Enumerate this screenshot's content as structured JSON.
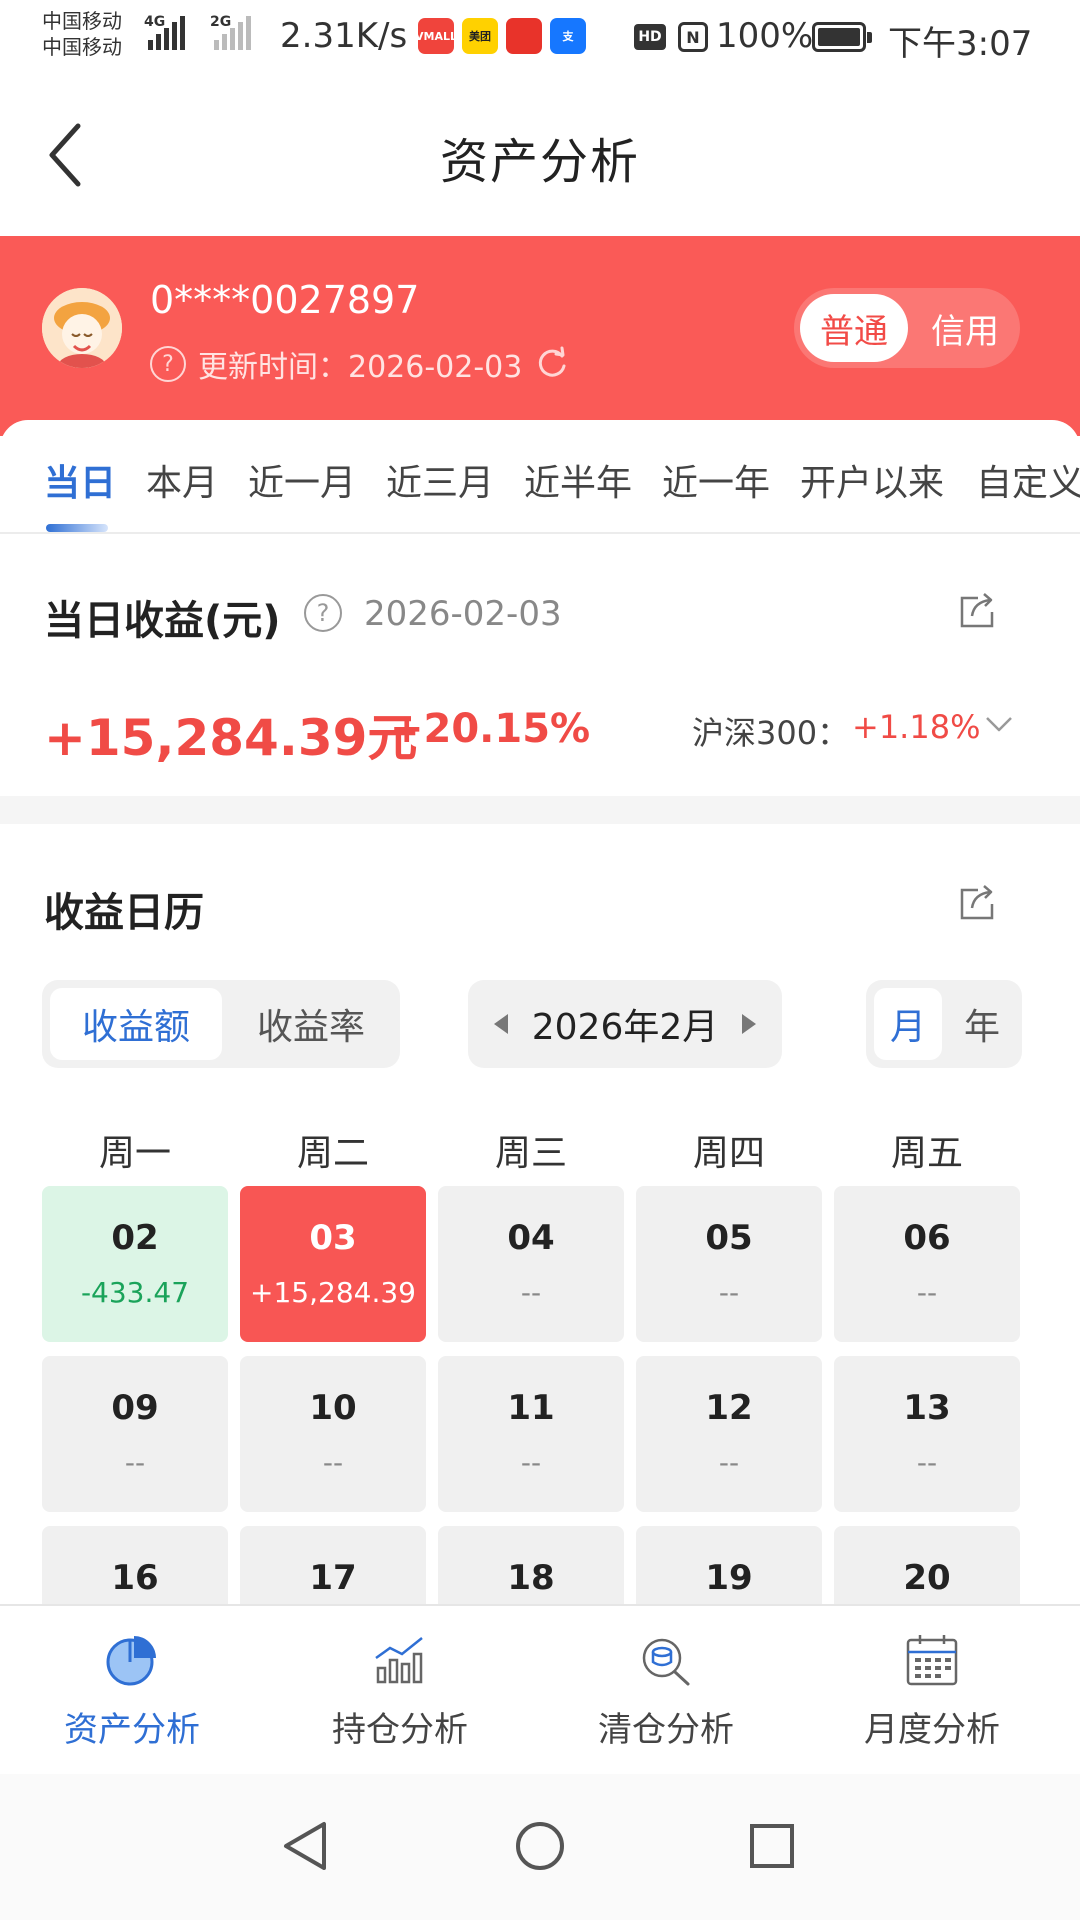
{
  "status_bar": {
    "carrier_1": "中国移动",
    "carrier_2": "中国移动",
    "signal_1_label": "4G",
    "signal_2_label": "2G",
    "net_speed": "2.31K/s",
    "apps": [
      {
        "name": "vmall-icon",
        "label": "VMALL",
        "color": "#f0443c"
      },
      {
        "name": "meituan-icon",
        "label": "美团",
        "color": "#ffd100"
      },
      {
        "name": "app-red-icon",
        "label": "",
        "color": "#e8332a"
      },
      {
        "name": "alipay-icon",
        "label": "支",
        "color": "#1677ff"
      }
    ],
    "hd_label": "HD",
    "nfc_label": "N",
    "battery_pct": "100%",
    "time": "下午3:07"
  },
  "header": {
    "title": "资产分析"
  },
  "account": {
    "number": "0****0027897",
    "update_time": "更新时间：2026-02-03",
    "toggle": {
      "active": "普通",
      "inactive": "信用"
    }
  },
  "period_tabs": [
    {
      "label": "当日",
      "active": true
    },
    {
      "label": "本月",
      "active": false
    },
    {
      "label": "近一月",
      "active": false
    },
    {
      "label": "近三月",
      "active": false
    },
    {
      "label": "近半年",
      "active": false
    },
    {
      "label": "近一年",
      "active": false
    },
    {
      "label": "开户以来",
      "active": false
    },
    {
      "label": "自定义",
      "active": false
    }
  ],
  "daily": {
    "title": "当日收益(元)",
    "date": "2026-02-03",
    "amount": "+15,284.39元",
    "percent": "+20.15%",
    "benchmark_label": "沪深300：",
    "benchmark_value": "+1.18%"
  },
  "calendar": {
    "title": "收益日历",
    "metric_toggle": {
      "active": "收益额",
      "inactive": "收益率"
    },
    "month": "2026年2月",
    "granularity": {
      "active": "月",
      "inactive": "年"
    },
    "weekdays": [
      "周一",
      "周二",
      "周三",
      "周四",
      "周五"
    ],
    "rows": [
      [
        {
          "day": "02",
          "value": "-433.47",
          "state": "loss"
        },
        {
          "day": "03",
          "value": "+15,284.39",
          "state": "gain"
        },
        {
          "day": "04",
          "value": "--",
          "state": "none"
        },
        {
          "day": "05",
          "value": "--",
          "state": "none"
        },
        {
          "day": "06",
          "value": "--",
          "state": "none"
        }
      ],
      [
        {
          "day": "09",
          "value": "--",
          "state": "none"
        },
        {
          "day": "10",
          "value": "--",
          "state": "none"
        },
        {
          "day": "11",
          "value": "--",
          "state": "none"
        },
        {
          "day": "12",
          "value": "--",
          "state": "none"
        },
        {
          "day": "13",
          "value": "--",
          "state": "none"
        }
      ],
      [
        {
          "day": "16",
          "value": "",
          "state": "none"
        },
        {
          "day": "17",
          "value": "",
          "state": "none"
        },
        {
          "day": "18",
          "value": "",
          "state": "none"
        },
        {
          "day": "19",
          "value": "",
          "state": "none"
        },
        {
          "day": "20",
          "value": "",
          "state": "none"
        }
      ]
    ]
  },
  "bottom_nav": [
    {
      "label": "资产分析",
      "icon": "pie-chart-icon",
      "active": true
    },
    {
      "label": "持仓分析",
      "icon": "bar-chart-icon",
      "active": false
    },
    {
      "label": "清仓分析",
      "icon": "coin-search-icon",
      "active": false
    },
    {
      "label": "月度分析",
      "icon": "calendar-icon",
      "active": false
    }
  ],
  "colors": {
    "brand_red": "#fa5a57",
    "accent_blue": "#2f6fd4",
    "gain_red": "#f04b46",
    "loss_green": "#1aa35a"
  }
}
